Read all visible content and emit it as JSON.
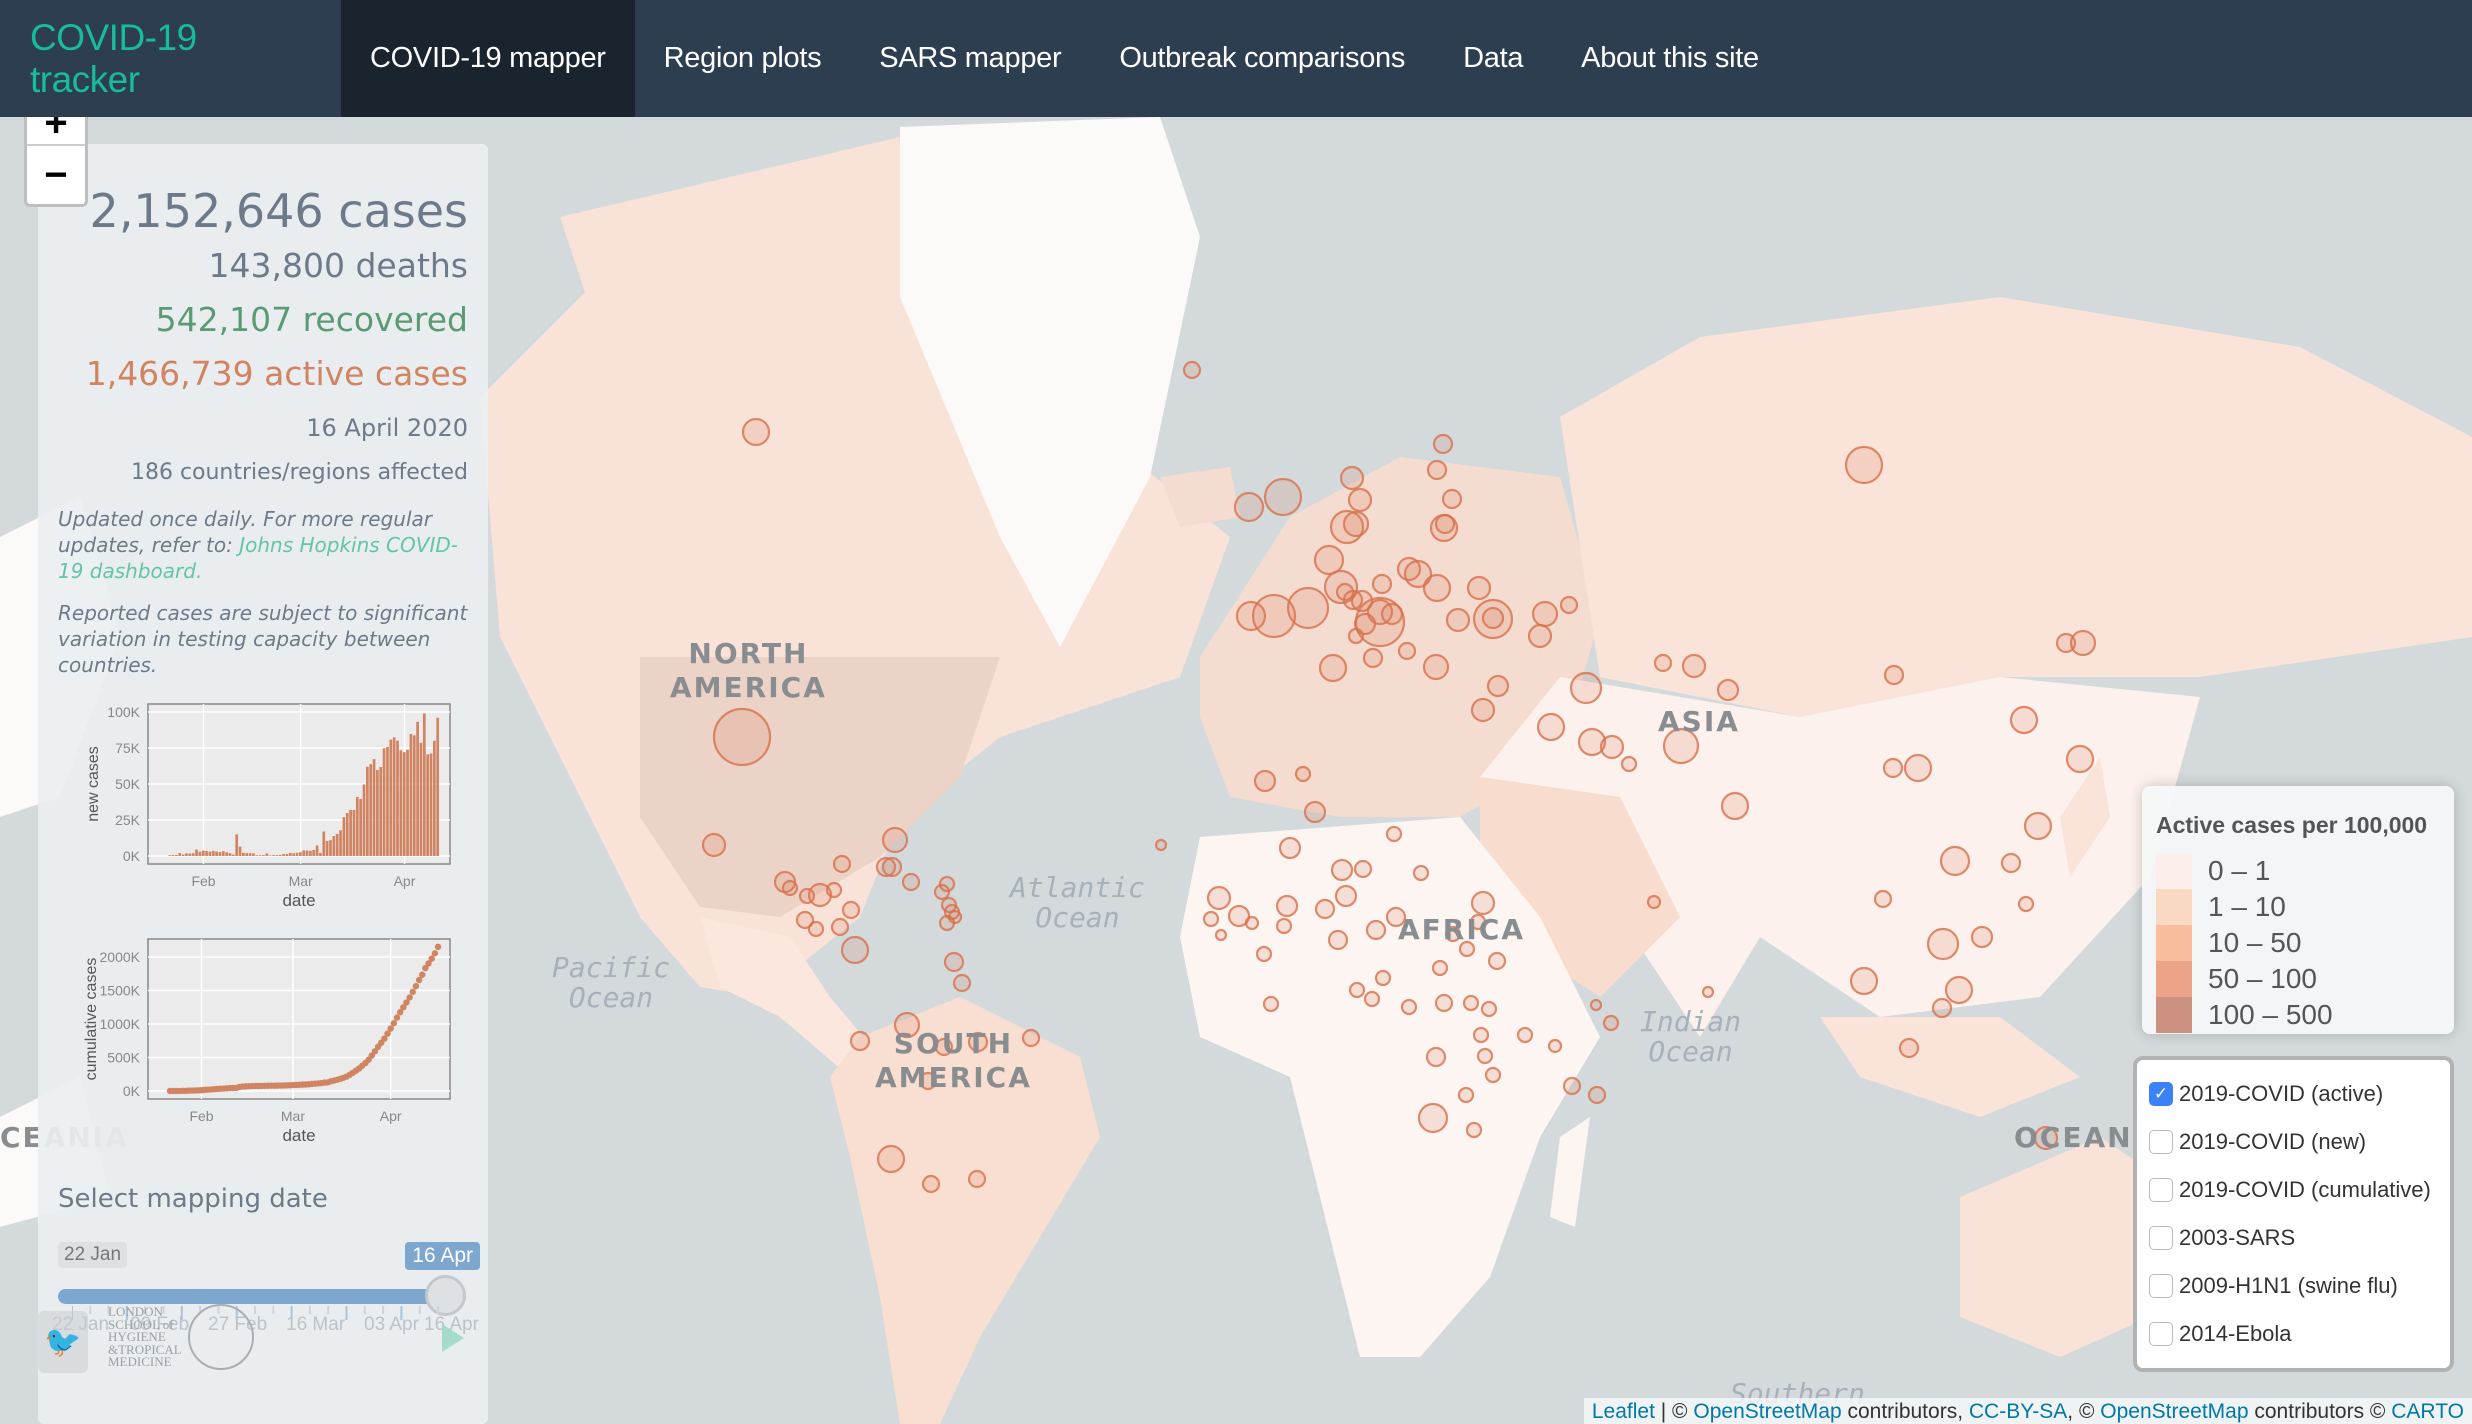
{
  "nav": {
    "brand": "COVID-19 tracker",
    "items": [
      {
        "label": "COVID-19 mapper",
        "active": true
      },
      {
        "label": "Region plots",
        "active": false
      },
      {
        "label": "SARS mapper",
        "active": false
      },
      {
        "label": "Outbreak comparisons",
        "active": false
      },
      {
        "label": "Data",
        "active": false
      },
      {
        "label": "About this site",
        "active": false
      }
    ]
  },
  "zoom": {
    "in": "+",
    "out": "−"
  },
  "summary": {
    "cases": "2,152,646 cases",
    "deaths": "143,800 deaths",
    "recovered": "542,107 recovered",
    "active": "1,466,739 active cases",
    "date": "16 April 2020",
    "countries": "186 countries/regions affected",
    "note1_prefix": "Updated once daily. For more regular updates, refer to: ",
    "note1_link": "Johns Hopkins COVID-19 dashboard.",
    "note2": "Reported cases are subject to significant variation in testing capacity between countries."
  },
  "colors": {
    "cases": "#6c7a89",
    "recovered": "#5c9a73",
    "active": "#d08462",
    "accent": "#18bc9c",
    "navbar": "#2c3e50",
    "bar": "#d08462"
  },
  "chart_data": [
    {
      "type": "bar",
      "title": "",
      "xlabel": "date",
      "ylabel": "new cases",
      "yticks": [
        "0K",
        "25K",
        "50K",
        "75K",
        "100K"
      ],
      "xticks": [
        "Feb",
        "Mar",
        "Apr"
      ],
      "ylim": [
        0,
        100000
      ],
      "x_start": "2020-01-22",
      "values": [
        550,
        650,
        600,
        2100,
        1000,
        1800,
        1700,
        1900,
        4500,
        3000,
        3800,
        3500,
        3000,
        3600,
        3100,
        2700,
        3300,
        2600,
        2000,
        900,
        15000,
        6500,
        2200,
        2000,
        1900,
        1800,
        500,
        500,
        600,
        1800,
        400,
        600,
        600,
        700,
        1300,
        1400,
        2100,
        1800,
        2300,
        2600,
        3900,
        3800,
        3600,
        4200,
        7300,
        2100,
        17000,
        10500,
        11000,
        13800,
        15300,
        17900,
        27000,
        29800,
        32000,
        32000,
        41000,
        39600,
        49700,
        62000,
        63800,
        67300,
        59700,
        61800,
        74800,
        75700,
        80900,
        82400,
        80100,
        73400,
        72100,
        73800,
        84800,
        83800,
        93200,
        78600,
        99000,
        70600,
        71200,
        80000,
        96000
      ]
    },
    {
      "type": "scatter",
      "title": "",
      "xlabel": "date",
      "ylabel": "cumulative cases",
      "yticks": [
        "0K",
        "500K",
        "1000K",
        "1500K",
        "2000K"
      ],
      "xticks": [
        "Feb",
        "Mar",
        "Apr"
      ],
      "ylim": [
        0,
        2150000
      ],
      "x_start": "2020-01-22",
      "values": [
        555,
        654,
        941,
        1434,
        2118,
        2927,
        5578,
        6166,
        8234,
        9927,
        12038,
        16787,
        19881,
        23892,
        27635,
        30794,
        34391,
        37120,
        40150,
        42762,
        44802,
        45221,
        60368,
        66885,
        69030,
        71224,
        73258,
        75136,
        75639,
        76197,
        76819,
        78572,
        78958,
        79561,
        80406,
        81388,
        82746,
        84112,
        86011,
        88369,
        90306,
        92840,
        95120,
        97886,
        101801,
        105847,
        109821,
        113590,
        118620,
        125875,
        128352,
        145205,
        156101,
        167454,
        181574,
        197102,
        214821,
        242570,
        272208,
        304507,
        336953,
        378231,
        418041,
        467653,
        529591,
        593291,
        660706,
        720117,
        782365,
        857487,
        932605,
        1013157,
        1095917,
        1176060,
        1249754,
        1321481,
        1396476,
        1480202,
        1565278,
        1657526,
        1735650,
        1834721,
        1904838,
        1976191,
        2056054,
        2152646
      ]
    }
  ],
  "slider": {
    "title": "Select mapping date",
    "min_label": "22 Jan",
    "current_label": "16 Apr",
    "value_fraction": 1.0,
    "tick_labels": [
      "22 Jan",
      "09 Feb",
      "27 Feb",
      "16 Mar",
      "03 Apr",
      "16 Apr"
    ]
  },
  "logo": {
    "lshtm_lines": [
      "LONDON",
      "SCHOOL of",
      "HYGIENE",
      "&TROPICAL",
      "MEDICINE"
    ]
  },
  "map_labels": {
    "north_america": [
      "NORTH",
      "AMERICA"
    ],
    "south_america": [
      "SOUTH",
      "AMERICA"
    ],
    "africa": "AFRICA",
    "asia": "ASIA",
    "oceania_left": "CEANIA",
    "oceania_right": "OCEANIA",
    "atlantic": [
      "Atlantic",
      "Ocean"
    ],
    "pacific": [
      "Pacific",
      "Ocean"
    ],
    "indian": [
      "Indian",
      "Ocean"
    ],
    "southern": "Southern"
  },
  "legend": {
    "title": "Active cases per 100,000",
    "items": [
      {
        "label": "0 – 1",
        "color": "#fcefeb"
      },
      {
        "label": "1 – 10",
        "color": "#f9d9c2"
      },
      {
        "label": "10 – 50",
        "color": "#f8bd9c"
      },
      {
        "label": "50 – 100",
        "color": "#eba487"
      },
      {
        "label": "100 – 500",
        "color": "#cd9182"
      }
    ]
  },
  "layers": [
    {
      "label": "2019-COVID (active)",
      "checked": true
    },
    {
      "label": "2019-COVID (new)",
      "checked": false
    },
    {
      "label": "2019-COVID (cumulative)",
      "checked": false
    },
    {
      "label": "2003-SARS",
      "checked": false
    },
    {
      "label": "2009-H1N1 (swine flu)",
      "checked": false
    },
    {
      "label": "2014-Ebola",
      "checked": false
    }
  ],
  "attribution": {
    "leaflet": "Leaflet",
    "sep": " | © ",
    "osm1": "OpenStreetMap",
    "contributors1": " contributors, ",
    "ccbysa": "CC-BY-SA",
    "sep2": ", © ",
    "osm2": "OpenStreetMap",
    "contributors2": " contributors © ",
    "carto": "CARTO"
  }
}
